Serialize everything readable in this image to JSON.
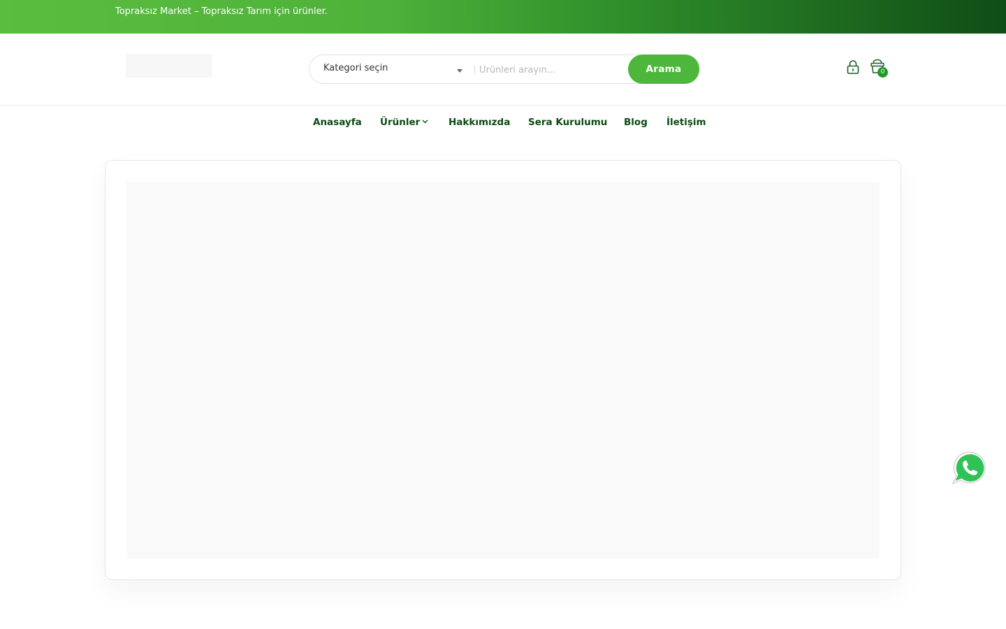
{
  "top_bar": {
    "text": "Topraksız Market – Topraksız Tarım için ürünler."
  },
  "search": {
    "category_label": "Kategori seçin",
    "placeholder": "Ürünleri arayın...",
    "button_label": "Arama"
  },
  "header_icons": {
    "account_icon": "lock-icon",
    "cart_icon": "shopping-bag-icon",
    "cart_count": "0"
  },
  "nav": {
    "items": [
      {
        "label": "Anasayfa",
        "has_dropdown": false
      },
      {
        "label": "Ürünler",
        "has_dropdown": true
      },
      {
        "label": "Hakkımızda",
        "has_dropdown": false
      },
      {
        "label": "Sera Kurulumu",
        "has_dropdown": false
      },
      {
        "label": "Blog",
        "has_dropdown": false
      },
      {
        "label": "İletişim",
        "has_dropdown": false
      }
    ]
  },
  "floating": {
    "whatsapp_icon": "whatsapp-icon"
  },
  "colors": {
    "brand_green": "#4cb73b",
    "nav_text": "#0c4a14",
    "gradient_end": "#0f4d16"
  }
}
